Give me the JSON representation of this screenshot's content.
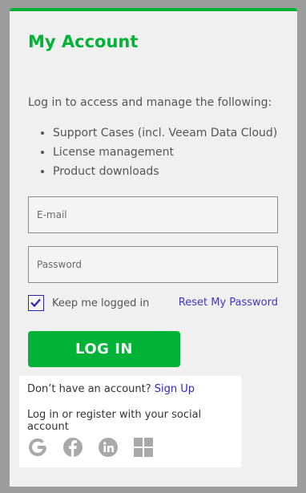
{
  "title": "My Account",
  "intro": "Log in to access and manage the following:",
  "features": [
    "Support Cases (incl. Veeam Data Cloud)",
    "License management",
    "Product downloads"
  ],
  "email": {
    "placeholder": "E-mail"
  },
  "password": {
    "placeholder": "Password"
  },
  "keep_logged_in": {
    "label": "Keep me logged in",
    "checked": true
  },
  "reset_password": "Reset My Password",
  "login_button": "LOG IN",
  "signup": {
    "prompt": "Don’t have an account?",
    "link": "Sign Up"
  },
  "social_text": "Log in or register with your social account",
  "social_icons": [
    "google-icon",
    "facebook-icon",
    "linkedin-icon",
    "microsoft-icon"
  ],
  "colors": {
    "accent": "#00b336",
    "link": "#3f35d0",
    "background": "#9c9c9c",
    "card": "#f0f0f0"
  }
}
